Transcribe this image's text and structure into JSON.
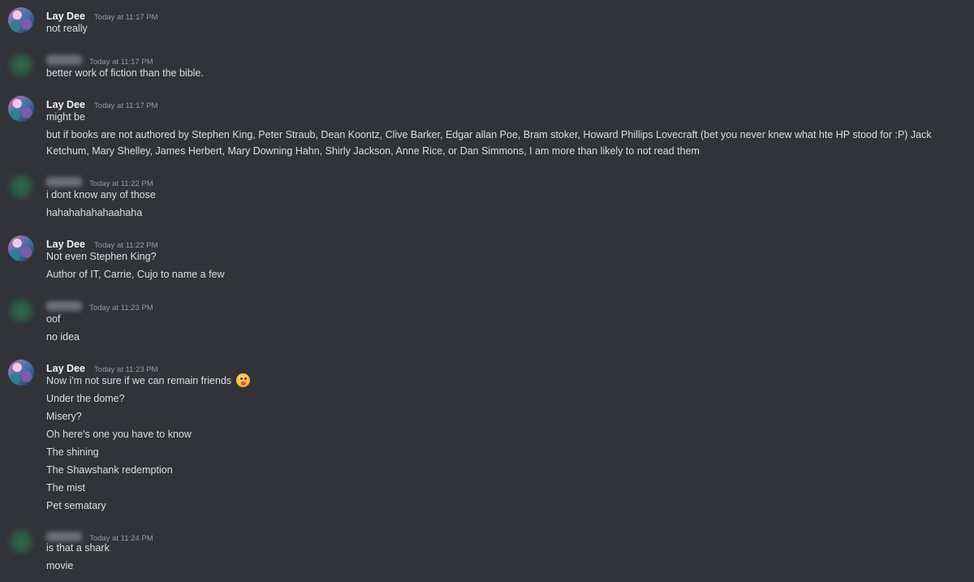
{
  "messages": [
    {
      "author": "Lay Dee",
      "time": "Today at 11:17 PM",
      "lines": [
        "not really"
      ]
    },
    {
      "author": "",
      "time": "Today at 11:17 PM",
      "lines": [
        "better work of fiction than the bible."
      ]
    },
    {
      "author": "Lay Dee",
      "time": "Today at 11:17 PM",
      "lines": [
        "might be",
        "but if books are not authored by Stephen King, Peter Straub, Dean Koontz, Clive Barker, Edgar allan Poe, Bram stoker, Howard Phillips Lovecraft (bet you never knew what hte HP stood for :P) Jack Ketchum, Mary Shelley, James Herbert,  Mary Downing Hahn, Shirly Jackson, Anne Rice, or Dan Simmons, I am more than likely to not read them"
      ]
    },
    {
      "author": "",
      "time": "Today at 11:22 PM",
      "lines": [
        "i dont know any of those",
        "hahahahahahaahaha"
      ]
    },
    {
      "author": "Lay Dee",
      "time": "Today at 11:22 PM",
      "lines": [
        "Not even Stephen King?",
        "Author of IT, Carrie, Cujo to name a few"
      ]
    },
    {
      "author": "",
      "time": "Today at 11:23 PM",
      "lines": [
        "oof",
        "no idea"
      ]
    },
    {
      "author": "Lay Dee",
      "time": "Today at 11:23 PM",
      "lines": [
        "Now i'm not sure if we can remain friends",
        "Under the dome?",
        "Misery?",
        "Oh here's one you have to know",
        "The shining",
        "The Shawshank redemption",
        "The mist",
        "Pet sematary"
      ],
      "emoji": "stuck-out-tongue-emoji"
    },
    {
      "author": "",
      "time": "Today at 11:24 PM",
      "lines": [
        "is that a shark",
        "movie"
      ]
    }
  ]
}
